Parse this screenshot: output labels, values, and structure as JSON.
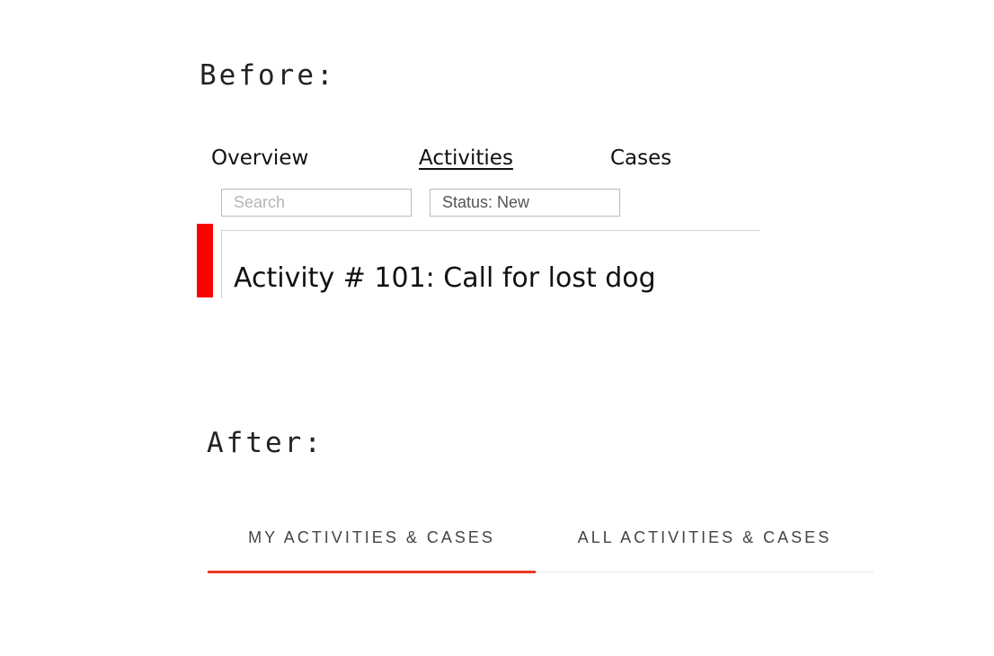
{
  "before": {
    "heading": "Before:",
    "nav": {
      "tabs": [
        {
          "label": "Overview"
        },
        {
          "label": "Activities",
          "active": true
        },
        {
          "label": "Cases"
        }
      ]
    },
    "filters": {
      "search_placeholder": "Search",
      "status_value": "Status: New"
    },
    "activity": {
      "title": "Activity # 101: Call for lost dog",
      "marker_color": "#ff0000"
    }
  },
  "after": {
    "heading": "After:",
    "tabs": [
      {
        "label": "MY ACTIVITIES & CASES",
        "active": true
      },
      {
        "label": "ALL ACTIVITIES & CASES",
        "active": false
      }
    ],
    "accent_color": "#ee3a25"
  }
}
